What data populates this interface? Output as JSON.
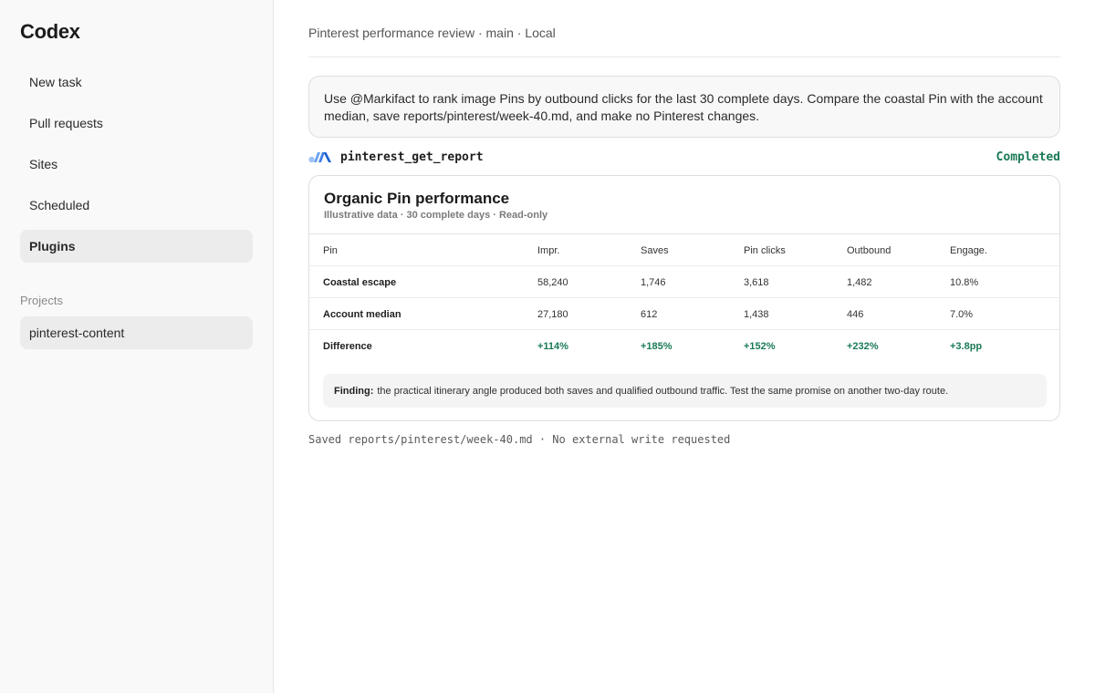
{
  "app": {
    "name": "Codex"
  },
  "sidebar": {
    "items": [
      {
        "label": "New task"
      },
      {
        "label": "Pull requests"
      },
      {
        "label": "Sites"
      },
      {
        "label": "Scheduled"
      },
      {
        "label": "Plugins",
        "active": true
      }
    ],
    "projects_label": "Projects",
    "projects": [
      {
        "label": "pinterest-content"
      }
    ]
  },
  "header": {
    "title": "Pinterest performance review · main · Local"
  },
  "prompt": {
    "text": "Use @Markifact to rank image Pins by outbound clicks for the last 30 complete days. Compare the coastal Pin with the account median, save reports/pinterest/week-40.md, and make no Pinterest changes."
  },
  "tool_call": {
    "icon": "markifact-logo-icon",
    "name": "pinterest_get_report",
    "status": "Completed",
    "status_color": "#1a7a56"
  },
  "report": {
    "title": "Organic Pin performance",
    "subtitle": "Illustrative data · 30 complete days · Read-only",
    "columns": [
      "Pin",
      "Impr.",
      "Saves",
      "Pin clicks",
      "Outbound",
      "Engage."
    ],
    "rows": [
      [
        "Coastal escape",
        "58,240",
        "1,746",
        "3,618",
        "1,482",
        "10.8%"
      ],
      [
        "Account median",
        "27,180",
        "612",
        "1,438",
        "446",
        "7.0%"
      ],
      [
        "Difference",
        "+114%",
        "+185%",
        "+152%",
        "+232%",
        "+3.8pp"
      ]
    ],
    "finding_label": "Finding:",
    "finding_text": "the practical itinerary angle produced both saves and qualified outbound traffic. Test the same promise on another two-day route."
  },
  "footer": {
    "note": "Saved reports/pinterest/week-40.md · No external write requested"
  }
}
